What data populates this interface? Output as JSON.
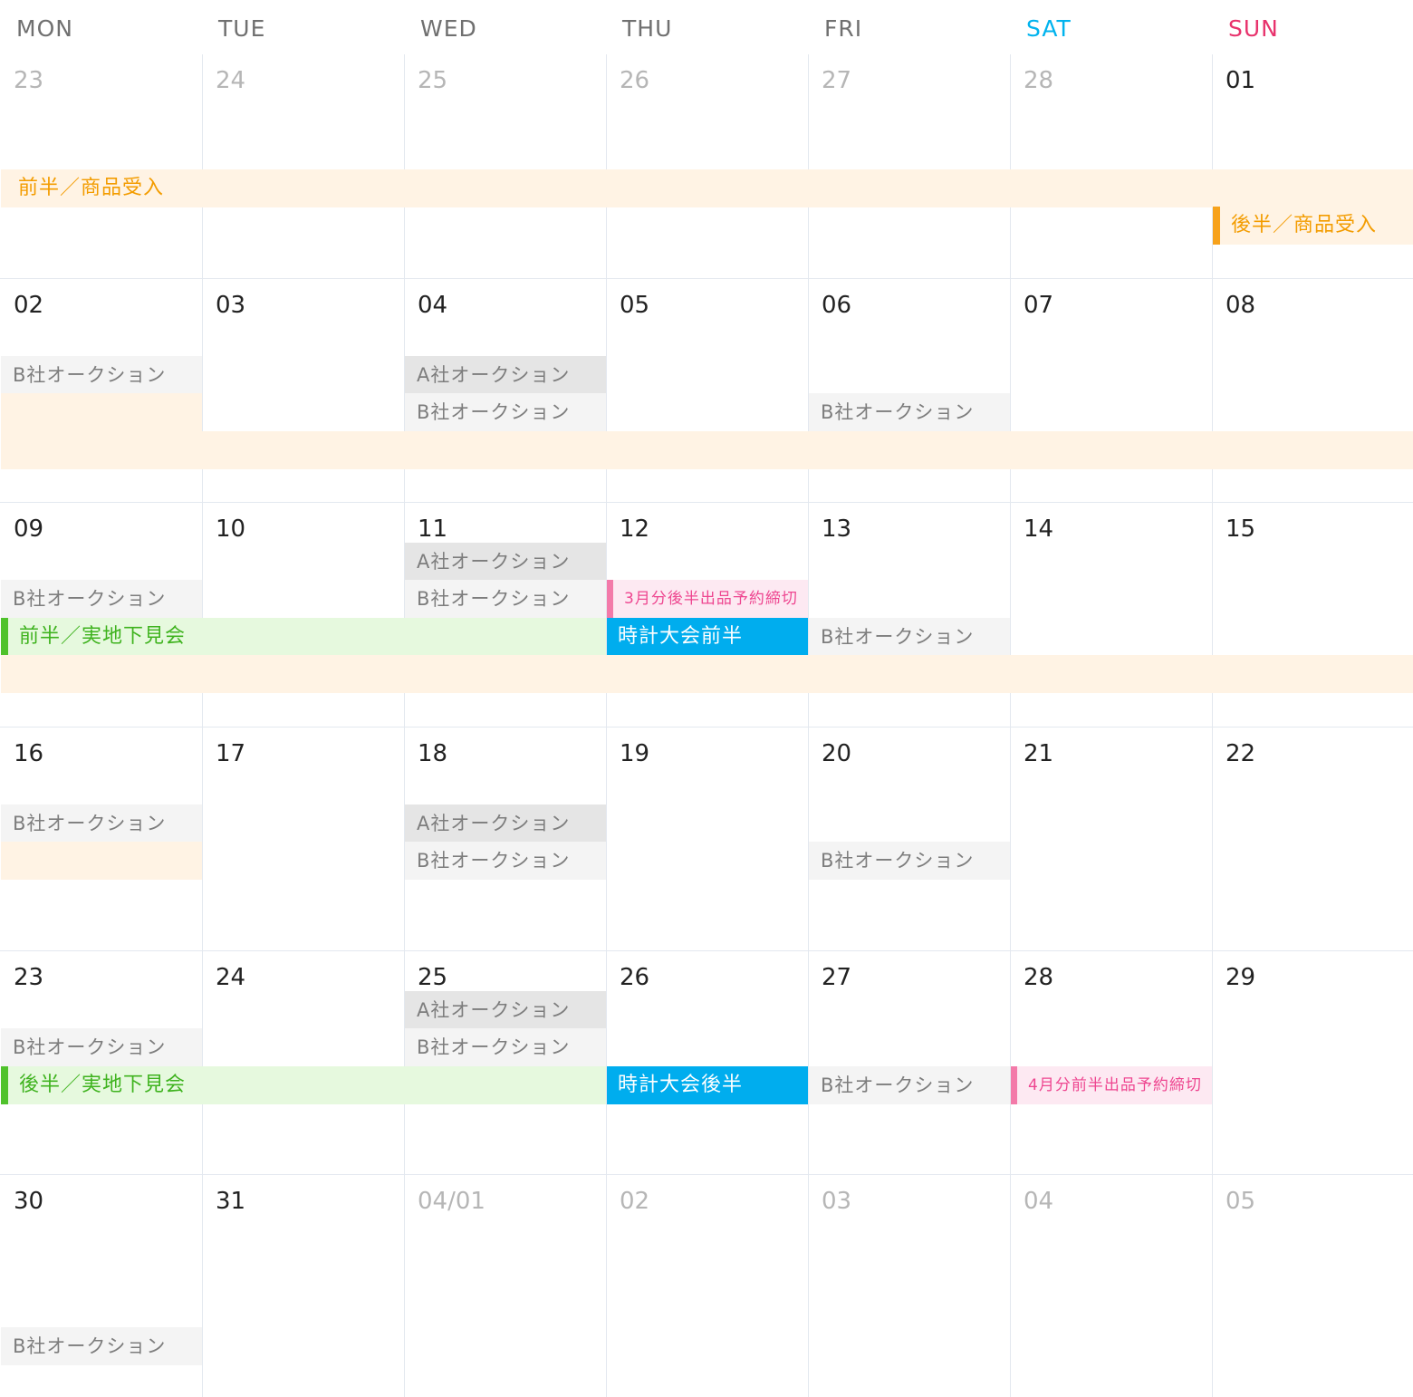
{
  "weekdays": [
    {
      "label": "MON",
      "kind": "normal"
    },
    {
      "label": "TUE",
      "kind": "normal"
    },
    {
      "label": "WED",
      "kind": "normal"
    },
    {
      "label": "THU",
      "kind": "normal"
    },
    {
      "label": "FRI",
      "kind": "normal"
    },
    {
      "label": "SAT",
      "kind": "sat"
    },
    {
      "label": "SUN",
      "kind": "sun"
    }
  ],
  "weeks": [
    {
      "days": [
        {
          "label": "23",
          "muted": true
        },
        {
          "label": "24",
          "muted": true
        },
        {
          "label": "25",
          "muted": true
        },
        {
          "label": "26",
          "muted": true
        },
        {
          "label": "27",
          "muted": true
        },
        {
          "label": "28",
          "muted": true
        },
        {
          "label": "01",
          "muted": false
        }
      ]
    },
    {
      "days": [
        {
          "label": "02",
          "muted": false
        },
        {
          "label": "03",
          "muted": false
        },
        {
          "label": "04",
          "muted": false
        },
        {
          "label": "05",
          "muted": false
        },
        {
          "label": "06",
          "muted": false
        },
        {
          "label": "07",
          "muted": false
        },
        {
          "label": "08",
          "muted": false
        }
      ]
    },
    {
      "days": [
        {
          "label": "09",
          "muted": false
        },
        {
          "label": "10",
          "muted": false
        },
        {
          "label": "11",
          "muted": false
        },
        {
          "label": "12",
          "muted": false
        },
        {
          "label": "13",
          "muted": false
        },
        {
          "label": "14",
          "muted": false
        },
        {
          "label": "15",
          "muted": false
        }
      ]
    },
    {
      "days": [
        {
          "label": "16",
          "muted": false
        },
        {
          "label": "17",
          "muted": false
        },
        {
          "label": "18",
          "muted": false
        },
        {
          "label": "19",
          "muted": false
        },
        {
          "label": "20",
          "muted": false
        },
        {
          "label": "21",
          "muted": false
        },
        {
          "label": "22",
          "muted": false
        }
      ]
    },
    {
      "days": [
        {
          "label": "23",
          "muted": false
        },
        {
          "label": "24",
          "muted": false
        },
        {
          "label": "25",
          "muted": false
        },
        {
          "label": "26",
          "muted": false
        },
        {
          "label": "27",
          "muted": false
        },
        {
          "label": "28",
          "muted": false
        },
        {
          "label": "29",
          "muted": false
        }
      ]
    },
    {
      "days": [
        {
          "label": "30",
          "muted": false
        },
        {
          "label": "31",
          "muted": false
        },
        {
          "label": "04/01",
          "muted": true
        },
        {
          "label": "02",
          "muted": true
        },
        {
          "label": "03",
          "muted": true
        },
        {
          "label": "04",
          "muted": true
        },
        {
          "label": "05",
          "muted": true
        }
      ]
    }
  ],
  "events": [
    {
      "week": 0,
      "slot": 3,
      "startCol": 0,
      "endCol": 6,
      "text": "前半／商品受入",
      "style": "orange",
      "bar": false
    },
    {
      "week": 0,
      "slot": 4,
      "startCol": 6,
      "endCol": 6,
      "text": "後半／商品受入",
      "style": "orange",
      "bar": true
    },
    {
      "week": 1,
      "slot": 2,
      "startCol": 0,
      "endCol": 0,
      "text": "B社オークション",
      "style": "grayB"
    },
    {
      "week": 1,
      "slot": 2,
      "startCol": 2,
      "endCol": 2,
      "text": "A社オークション",
      "style": "grayA"
    },
    {
      "week": 1,
      "slot": 3,
      "startCol": 0,
      "endCol": 0,
      "text": "",
      "style": "peach"
    },
    {
      "week": 1,
      "slot": 3,
      "startCol": 2,
      "endCol": 2,
      "text": "B社オークション",
      "style": "grayB"
    },
    {
      "week": 1,
      "slot": 3,
      "startCol": 4,
      "endCol": 4,
      "text": "B社オークション",
      "style": "grayB"
    },
    {
      "week": 1,
      "slot": 4,
      "startCol": 0,
      "endCol": 6,
      "text": "",
      "style": "peach"
    },
    {
      "week": 2,
      "slot": 1,
      "startCol": 2,
      "endCol": 2,
      "text": "A社オークション",
      "style": "grayA"
    },
    {
      "week": 2,
      "slot": 2,
      "startCol": 0,
      "endCol": 0,
      "text": "B社オークション",
      "style": "grayB"
    },
    {
      "week": 2,
      "slot": 2,
      "startCol": 2,
      "endCol": 2,
      "text": "B社オークション",
      "style": "grayB"
    },
    {
      "week": 2,
      "slot": 2,
      "startCol": 3,
      "endCol": 3,
      "text": "3月分後半出品予約締切",
      "style": "pink"
    },
    {
      "week": 2,
      "slot": 3,
      "startCol": 0,
      "endCol": 2,
      "text": "前半／実地下見会",
      "style": "green",
      "bar": true
    },
    {
      "week": 2,
      "slot": 3,
      "startCol": 3,
      "endCol": 3,
      "text": "時計大会前半",
      "style": "blue"
    },
    {
      "week": 2,
      "slot": 3,
      "startCol": 4,
      "endCol": 4,
      "text": "B社オークション",
      "style": "grayB"
    },
    {
      "week": 2,
      "slot": 4,
      "startCol": 0,
      "endCol": 6,
      "text": "",
      "style": "peach"
    },
    {
      "week": 3,
      "slot": 2,
      "startCol": 0,
      "endCol": 0,
      "text": "B社オークション",
      "style": "grayB"
    },
    {
      "week": 3,
      "slot": 2,
      "startCol": 2,
      "endCol": 2,
      "text": "A社オークション",
      "style": "grayA"
    },
    {
      "week": 3,
      "slot": 3,
      "startCol": 0,
      "endCol": 0,
      "text": "",
      "style": "peach"
    },
    {
      "week": 3,
      "slot": 3,
      "startCol": 2,
      "endCol": 2,
      "text": "B社オークション",
      "style": "grayB"
    },
    {
      "week": 3,
      "slot": 3,
      "startCol": 4,
      "endCol": 4,
      "text": "B社オークション",
      "style": "grayB"
    },
    {
      "week": 4,
      "slot": 1,
      "startCol": 2,
      "endCol": 2,
      "text": "A社オークション",
      "style": "grayA"
    },
    {
      "week": 4,
      "slot": 2,
      "startCol": 0,
      "endCol": 0,
      "text": "B社オークション",
      "style": "grayB"
    },
    {
      "week": 4,
      "slot": 2,
      "startCol": 2,
      "endCol": 2,
      "text": "B社オークション",
      "style": "grayB"
    },
    {
      "week": 4,
      "slot": 3,
      "startCol": 0,
      "endCol": 2,
      "text": "後半／実地下見会",
      "style": "green",
      "bar": true
    },
    {
      "week": 4,
      "slot": 3,
      "startCol": 3,
      "endCol": 3,
      "text": "時計大会後半",
      "style": "blue"
    },
    {
      "week": 4,
      "slot": 3,
      "startCol": 4,
      "endCol": 4,
      "text": "B社オークション",
      "style": "grayB"
    },
    {
      "week": 4,
      "slot": 3,
      "startCol": 5,
      "endCol": 5,
      "text": "4月分前半出品予約締切",
      "style": "pink"
    },
    {
      "week": 5,
      "slot": 4,
      "startCol": 0,
      "endCol": 0,
      "text": "B社オークション",
      "style": "grayB"
    }
  ]
}
